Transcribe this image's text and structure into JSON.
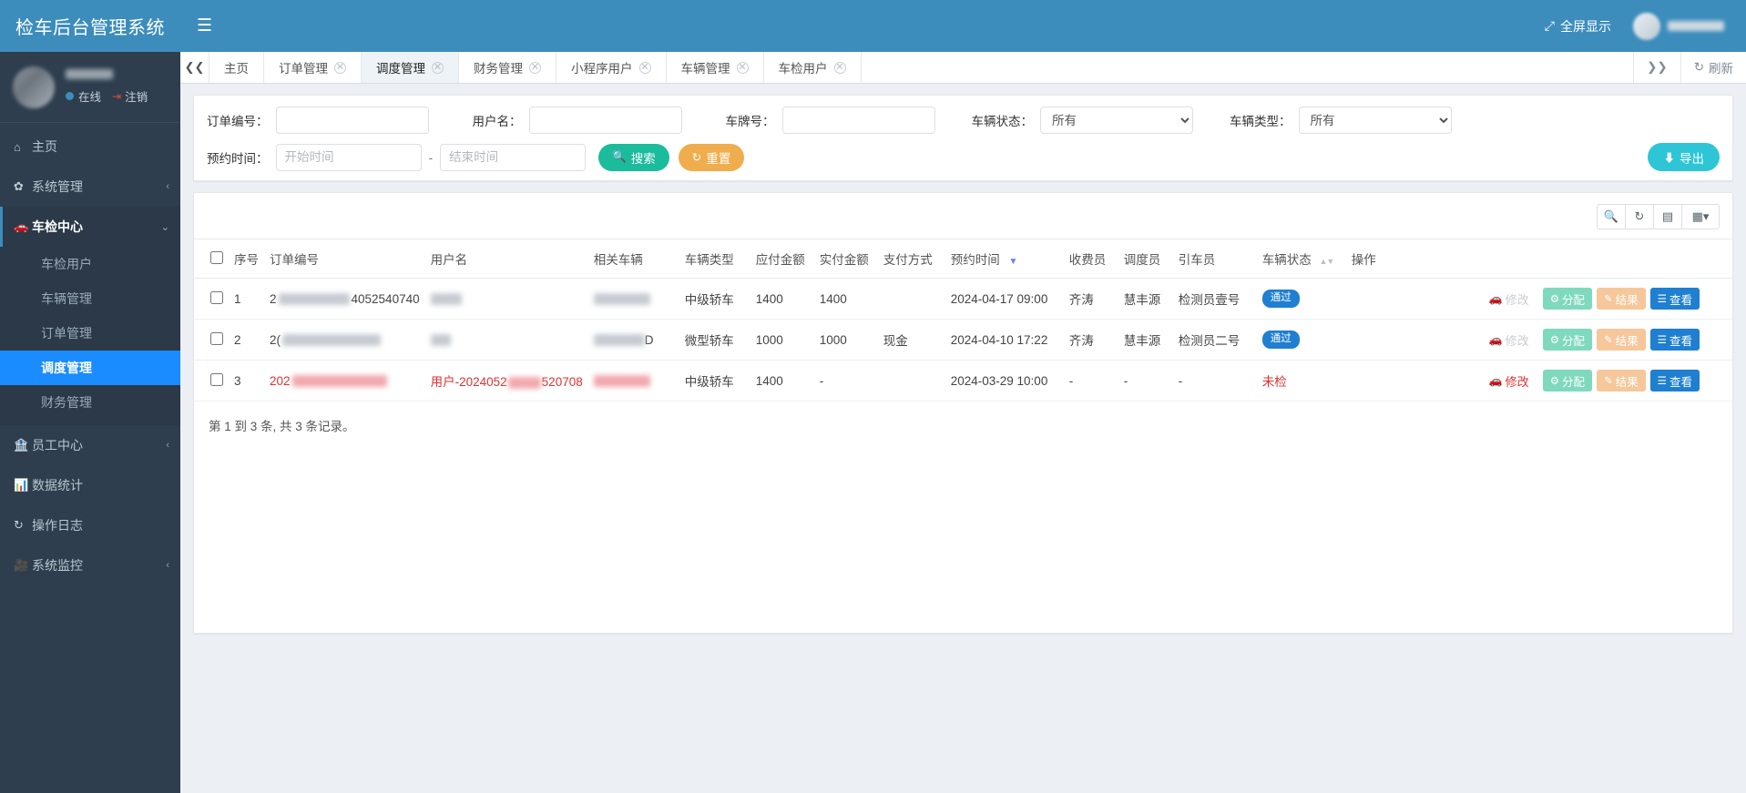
{
  "brand": {
    "title": "检车后台管理系统"
  },
  "user_panel": {
    "status_text": "在线",
    "logout_label": "注销"
  },
  "topbar": {
    "menu_toggle_icon": "hamburger-icon",
    "fullscreen_label": "全屏显示",
    "fullscreen_icon": "expand-icon"
  },
  "sidebar": {
    "items": [
      {
        "label": "主页",
        "icon": "home-icon",
        "caret": "",
        "active": false
      },
      {
        "label": "系统管理",
        "icon": "gear-icon",
        "caret": "‹",
        "active": false
      },
      {
        "label": "车检中心",
        "icon": "car-icon",
        "caret": "⌄",
        "active": true
      },
      {
        "label": "员工中心",
        "icon": "bank-icon",
        "caret": "‹",
        "active": false
      },
      {
        "label": "数据统计",
        "icon": "bar-chart-icon",
        "caret": "",
        "active": false
      },
      {
        "label": "操作日志",
        "icon": "refresh-icon",
        "caret": "",
        "active": false
      },
      {
        "label": "系统监控",
        "icon": "video-icon",
        "caret": "‹",
        "active": false
      }
    ],
    "submenu": [
      {
        "label": "车检用户",
        "active": false
      },
      {
        "label": "车辆管理",
        "active": false
      },
      {
        "label": "订单管理",
        "active": false
      },
      {
        "label": "调度管理",
        "active": true
      },
      {
        "label": "财务管理",
        "active": false
      }
    ]
  },
  "tabstrip": {
    "prev_icon": "double-chevron-left-icon",
    "next_icon": "double-chevron-right-icon",
    "refresh_label": "刷新",
    "refresh_icon": "refresh-icon",
    "tabs": [
      {
        "label": "主页",
        "closable": false,
        "active": false
      },
      {
        "label": "订单管理",
        "closable": true,
        "active": false
      },
      {
        "label": "调度管理",
        "closable": true,
        "active": true
      },
      {
        "label": "财务管理",
        "closable": true,
        "active": false
      },
      {
        "label": "小程序用户",
        "closable": true,
        "active": false
      },
      {
        "label": "车辆管理",
        "closable": true,
        "active": false
      },
      {
        "label": "车检用户",
        "closable": true,
        "active": false
      }
    ]
  },
  "filters": {
    "order_no": {
      "label": "订单编号：",
      "value": "",
      "placeholder": ""
    },
    "user_name": {
      "label": "用户名：",
      "value": "",
      "placeholder": ""
    },
    "plate_no": {
      "label": "车牌号：",
      "value": "",
      "placeholder": ""
    },
    "car_status": {
      "label": "车辆状态：",
      "value": "所有",
      "options": [
        "所有"
      ]
    },
    "car_type": {
      "label": "车辆类型：",
      "value": "所有",
      "options": [
        "所有"
      ]
    },
    "appointment_time": {
      "label": "预约时间：",
      "start_placeholder": "开始时间",
      "end_placeholder": "结束时间",
      "start_value": "",
      "end_value": "",
      "separator": "-"
    },
    "search_button": {
      "label": "搜索",
      "icon": "search-icon"
    },
    "reset_button": {
      "label": "重置",
      "icon": "refresh-icon"
    },
    "export_button": {
      "label": "导出",
      "icon": "download-icon"
    }
  },
  "table_tools": [
    {
      "name": "search-icon",
      "glyph": "⌕"
    },
    {
      "name": "refresh-icon",
      "glyph": "⟳"
    },
    {
      "name": "print-icon",
      "glyph": "▤"
    },
    {
      "name": "columns-icon",
      "glyph": "▦"
    }
  ],
  "table": {
    "columns": [
      {
        "key": "checkbox",
        "label": ""
      },
      {
        "key": "index",
        "label": "序号"
      },
      {
        "key": "order_no",
        "label": "订单编号"
      },
      {
        "key": "user_name",
        "label": "用户名"
      },
      {
        "key": "related_car",
        "label": "相关车辆"
      },
      {
        "key": "car_type",
        "label": "车辆类型"
      },
      {
        "key": "payable",
        "label": "应付金额"
      },
      {
        "key": "paid",
        "label": "实付金额"
      },
      {
        "key": "pay_method",
        "label": "支付方式"
      },
      {
        "key": "appoint_time",
        "label": "预约时间",
        "sort": "desc"
      },
      {
        "key": "cashier",
        "label": "收费员"
      },
      {
        "key": "dispatcher",
        "label": "调度员"
      },
      {
        "key": "driver",
        "label": "引车员"
      },
      {
        "key": "car_status",
        "label": "车辆状态",
        "sort": "both"
      },
      {
        "key": "ops",
        "label": "操作"
      }
    ],
    "rows": [
      {
        "index": "1",
        "order_no": "2",
        "order_no_tail": "4052540740",
        "user_name": "",
        "related_car": "",
        "car_type": "中级轿车",
        "payable": "1400",
        "paid": "1400",
        "pay_method": "",
        "appoint_time": "2024-04-17 09:00",
        "cashier": "齐涛",
        "dispatcher": "慧丰源",
        "driver": "检测员壹号",
        "car_status": "通过",
        "status_kind": "badge",
        "alert": false,
        "ops": {
          "edit": "修改",
          "assign": "分配",
          "result": "结果",
          "view": "查看",
          "edit_enabled": false
        }
      },
      {
        "index": "2",
        "order_no": "2(",
        "order_no_tail": "",
        "user_name": "",
        "related_car": "D",
        "car_type": "微型轿车",
        "payable": "1000",
        "paid": "1000",
        "pay_method": "现金",
        "appoint_time": "2024-04-10 17:22",
        "cashier": "齐涛",
        "dispatcher": "慧丰源",
        "driver": "检测员二号",
        "car_status": "通过",
        "status_kind": "badge",
        "alert": false,
        "ops": {
          "edit": "修改",
          "assign": "分配",
          "result": "结果",
          "view": "查看",
          "edit_enabled": false
        }
      },
      {
        "index": "3",
        "order_no": "202",
        "order_no_tail": "",
        "user_name": "用户-2024052",
        "user_name_tail": "520708",
        "related_car": "",
        "car_type": "中级轿车",
        "payable": "1400",
        "paid": "-",
        "pay_method": "",
        "appoint_time": "2024-03-29 10:00",
        "cashier": "-",
        "dispatcher": "-",
        "driver": "-",
        "car_status": "未检",
        "status_kind": "text",
        "alert": true,
        "ops": {
          "edit": "修改",
          "assign": "分配",
          "result": "结果",
          "view": "查看",
          "edit_enabled": true
        }
      }
    ],
    "footer_text": "第 1 到 3 条, 共 3 条记录。"
  },
  "colors": {
    "brand_blue": "#3c8dbc",
    "sidebar_dark": "#2e3e4e",
    "active_blue": "#1a8cff",
    "search_green": "#1abc9c",
    "reset_orange": "#f0ad4e",
    "export_cyan": "#2ec6d6",
    "badge_blue": "#1f7fd0",
    "alert_red": "#e03131",
    "assign_green": "#7fd9bd",
    "result_peach": "#f6c79a"
  }
}
